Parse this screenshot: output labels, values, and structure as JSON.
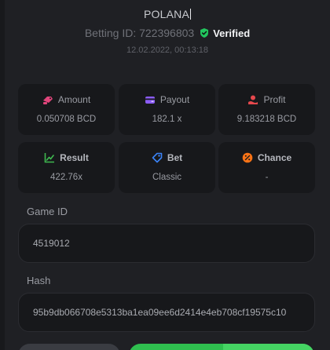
{
  "header": {
    "player": "POLANA",
    "bet_id_label": "Betting ID: 722396803",
    "verified_label": "Verified",
    "date": "12.02.2022, 00:13:18"
  },
  "stats": {
    "amount": {
      "label": "Amount",
      "value": "0.050708 BCD"
    },
    "payout": {
      "label": "Payout",
      "value": "182.1 x"
    },
    "profit": {
      "label": "Profit",
      "value": "9.183218 BCD"
    },
    "result": {
      "label": "Result",
      "value": "422.76x"
    },
    "bet": {
      "label": "Bet",
      "value": "Classic"
    },
    "chance": {
      "label": "Chance",
      "value": "-"
    }
  },
  "game": {
    "label": "Game ID",
    "value": "4519012"
  },
  "hash": {
    "label": "Hash",
    "value": "95b9db066708e5313ba1ea09ee6d2414e4eb708cf19575c10"
  },
  "colors": {
    "verified_green": "#22c55e",
    "amount_icon": "#e0457b",
    "payout_icon": "#8b5cf6",
    "profit_icon": "#e5484d",
    "result_icon": "#3fb950",
    "bet_icon": "#3b82f6",
    "chance_icon": "#f97316",
    "button_green": "#2fbf4f"
  }
}
